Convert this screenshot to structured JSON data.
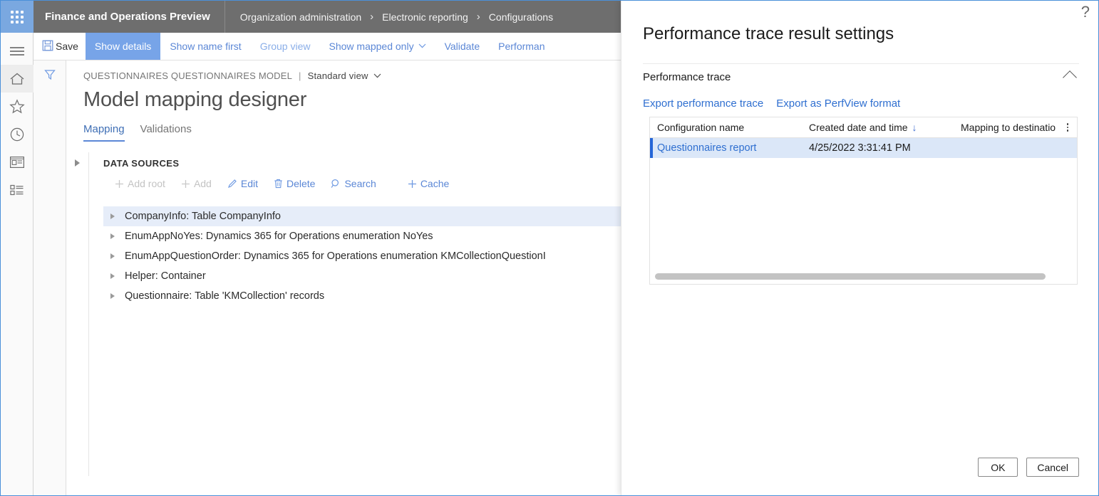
{
  "topbar": {
    "waffle_icon": "waffle-grid-icon",
    "app_title": "Finance and Operations Preview",
    "breadcrumb": [
      {
        "label": "Organization administration"
      },
      {
        "label": "Electronic reporting"
      },
      {
        "label": "Configurations"
      }
    ],
    "separator": "›"
  },
  "left_rail": {
    "items": [
      {
        "name": "menu-icon",
        "glyph": "hamburger"
      },
      {
        "name": "home-icon",
        "glyph": "home"
      },
      {
        "name": "favorites-star-icon",
        "glyph": "star"
      },
      {
        "name": "recent-clock-icon",
        "glyph": "clock"
      },
      {
        "name": "workspaces-icon",
        "glyph": "workspace"
      },
      {
        "name": "modules-list-icon",
        "glyph": "list"
      }
    ]
  },
  "command_bar": {
    "save_label": "Save",
    "save_icon": "save-floppy-icon",
    "items": [
      {
        "label": "Show details",
        "state": "selected"
      },
      {
        "label": "Show name first",
        "state": "link"
      },
      {
        "label": "Group view",
        "state": "muted"
      },
      {
        "label": "Show mapped only",
        "state": "link",
        "caret": "⌵"
      },
      {
        "label": "Validate",
        "state": "link"
      },
      {
        "label": "Performan",
        "state": "link"
      }
    ]
  },
  "page": {
    "filter_icon": "filter-funnel-icon",
    "caption": "QUESTIONNAIRES QUESTIONNAIRES MODEL",
    "caption_separator": "|",
    "view_selector": "Standard view",
    "view_selector_chevron": "⌵",
    "title": "Model mapping designer",
    "tabs": [
      {
        "label": "Mapping",
        "active": true
      },
      {
        "label": "Validations",
        "active": false
      }
    ],
    "data_sources": {
      "header": "DATA SOURCES",
      "toolbar": [
        {
          "label": "Add root",
          "icon": "plus-icon",
          "glyph": "+",
          "disabled": true
        },
        {
          "label": "Add",
          "icon": "plus-icon",
          "glyph": "+",
          "disabled": true
        },
        {
          "label": "Edit",
          "icon": "pencil-icon",
          "glyph": "✎",
          "disabled": false
        },
        {
          "label": "Delete",
          "icon": "trash-icon",
          "glyph": "🗑",
          "disabled": false
        },
        {
          "label": "Search",
          "icon": "search-icon",
          "glyph": "⚲",
          "disabled": false
        },
        {
          "label": "Cache",
          "icon": "plus-icon",
          "glyph": "+",
          "disabled": false
        }
      ],
      "rows": [
        {
          "label": "CompanyInfo: Table CompanyInfo",
          "selected": true
        },
        {
          "label": "EnumAppNoYes: Dynamics 365 for Operations enumeration NoYes",
          "selected": false
        },
        {
          "label": "EnumAppQuestionOrder: Dynamics 365 for Operations enumeration KMCollectionQuestionI",
          "selected": false
        },
        {
          "label": "Helper: Container",
          "selected": false
        },
        {
          "label": "Questionnaire: Table 'KMCollection' records",
          "selected": false
        }
      ]
    }
  },
  "dialog": {
    "help_icon": "question-mark-icon",
    "help_glyph": "?",
    "title": "Performance trace result settings",
    "section_label": "Performance trace",
    "section_chevron_icon": "chevron-up-icon",
    "links": [
      {
        "label": "Export performance trace"
      },
      {
        "label": "Export as PerfView format"
      }
    ],
    "grid": {
      "columns": [
        {
          "label": "Configuration name",
          "sorted": false
        },
        {
          "label": "Created date and time",
          "sorted": true,
          "sort_glyph": "↓"
        },
        {
          "label": "Mapping to destinatio",
          "sorted": false
        }
      ],
      "column_menu_icon": "column-options-ellipsis-icon",
      "rows": [
        {
          "configuration_name": "Questionnaires report",
          "created_date_and_time": "4/25/2022 3:31:41 PM",
          "mapping_to_destination": "",
          "selected": true
        }
      ],
      "horizontal_scrollbar": "grid-horizontal-scrollbar"
    },
    "buttons": [
      {
        "label": "OK",
        "name": "ok-button"
      },
      {
        "label": "Cancel",
        "name": "cancel-button"
      }
    ]
  },
  "colors": {
    "accent_blue": "#5b87d6",
    "header_grey": "#6e6e6e",
    "link_blue": "#2f6fd0",
    "selection_blue": "#dbe7f8",
    "selection_bar": "#2566d8"
  }
}
